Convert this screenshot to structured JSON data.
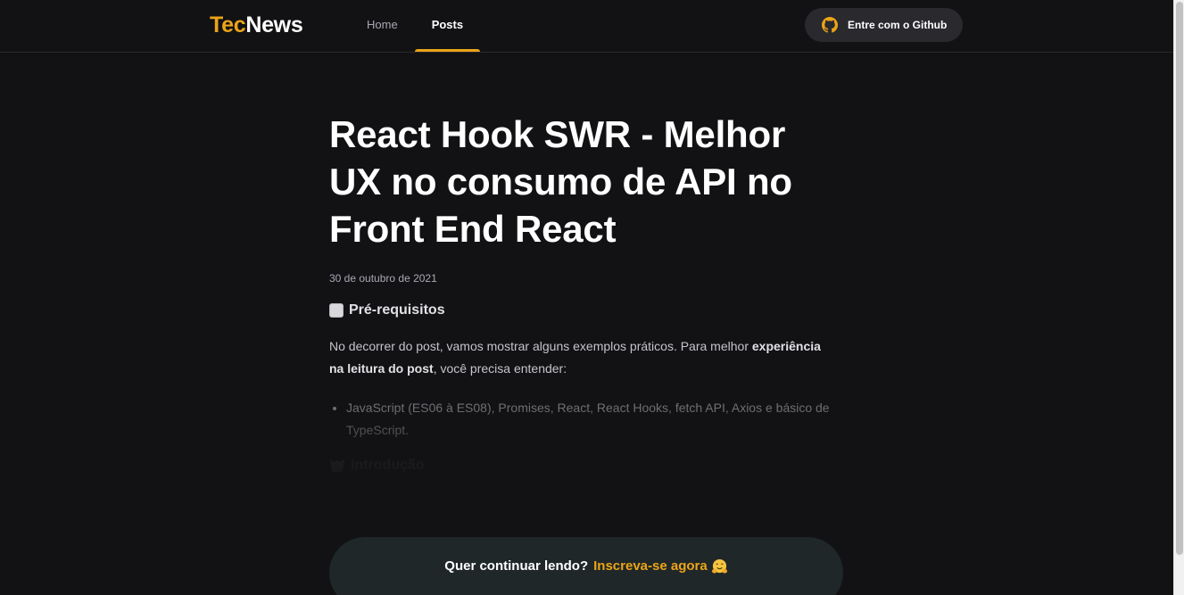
{
  "header": {
    "logo_accent": "Tec",
    "logo_main": "News",
    "nav": [
      {
        "label": "Home",
        "active": false
      },
      {
        "label": "Posts",
        "active": true
      }
    ],
    "github_button": "Entre com o Github",
    "icon": "github-icon"
  },
  "post": {
    "title": "React Hook SWR - Melhor UX no consumo de API no Front End React",
    "date": "30 de outubro de 2021",
    "prereq_heading": "Pré-requisitos",
    "paragraph_before": "No decorrer do post, vamos mostrar alguns exemplos práticos. Para melhor ",
    "paragraph_bold": "experiência na leitura do post",
    "paragraph_after": ", você precisa entender:",
    "list_items": [
      "JavaScript (ES06 à ES08), Promises, React, React Hooks, fetch API, Axios e básico de TypeScript."
    ],
    "intro_heading": "Introdução"
  },
  "continue_banner": {
    "text": "Quer continuar lendo?",
    "link": "Inscreva-se agora",
    "emoji": "hugging-face-emoji"
  },
  "colors": {
    "accent": "#eba417",
    "background": "#121214",
    "header_border": "#29292e",
    "banner_bg": "#1f2729"
  }
}
